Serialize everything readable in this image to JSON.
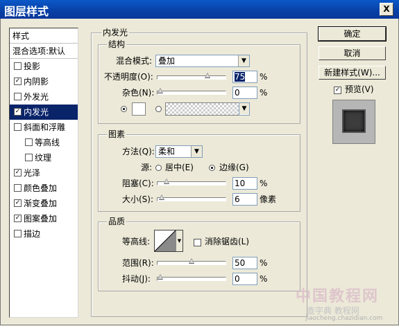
{
  "window": {
    "title": "图层样式",
    "close_label": "X"
  },
  "styles_panel": {
    "header": "样式",
    "blend_default": "混合选项:默认",
    "items": [
      {
        "label": "投影",
        "checked": false
      },
      {
        "label": "内阴影",
        "checked": true
      },
      {
        "label": "外发光",
        "checked": false
      },
      {
        "label": "内发光",
        "checked": true,
        "selected": true
      },
      {
        "label": "斜面和浮雕",
        "checked": false
      },
      {
        "label": "等高线",
        "checked": false,
        "sub": true
      },
      {
        "label": "纹理",
        "checked": false,
        "sub": true
      },
      {
        "label": "光泽",
        "checked": true
      },
      {
        "label": "颜色叠加",
        "checked": false
      },
      {
        "label": "渐变叠加",
        "checked": true
      },
      {
        "label": "图案叠加",
        "checked": true
      },
      {
        "label": "描边",
        "checked": false
      }
    ]
  },
  "inner_glow": {
    "title": "内发光",
    "structure": {
      "title": "结构",
      "blend_mode_label": "混合模式:",
      "blend_mode_value": "叠加",
      "opacity_label": "不透明度(O):",
      "opacity_value": "75",
      "opacity_unit": "%",
      "opacity_level": 0.75,
      "noise_label": "杂色(N):",
      "noise_value": "0",
      "noise_unit": "%",
      "noise_level": 0
    },
    "elements": {
      "title": "图素",
      "technique_label": "方法(Q):",
      "technique_value": "柔和",
      "source_label": "源:",
      "source_center": "居中(E)",
      "source_edge": "边缘(G)",
      "choke_label": "阻塞(C):",
      "choke_value": "10",
      "choke_unit": "%",
      "choke_level": 0.1,
      "size_label": "大小(S):",
      "size_value": "6",
      "size_unit": "像素",
      "size_level": 0.024
    },
    "quality": {
      "title": "品质",
      "contour_label": "等高线:",
      "antialias_label": "消除锯齿(L)",
      "range_label": "范围(R):",
      "range_value": "50",
      "range_unit": "%",
      "range_level": 0.5,
      "jitter_label": "抖动(J):",
      "jitter_value": "0",
      "jitter_unit": "%",
      "jitter_level": 0
    }
  },
  "buttons": {
    "ok": "确定",
    "cancel": "取消",
    "new_style": "新建样式(W)...",
    "preview_label": "预览(V)"
  },
  "watermark": {
    "line1": "中国教程网",
    "line2": "查字典 教程网",
    "line3": "jiaocheng.chazidian.com"
  }
}
